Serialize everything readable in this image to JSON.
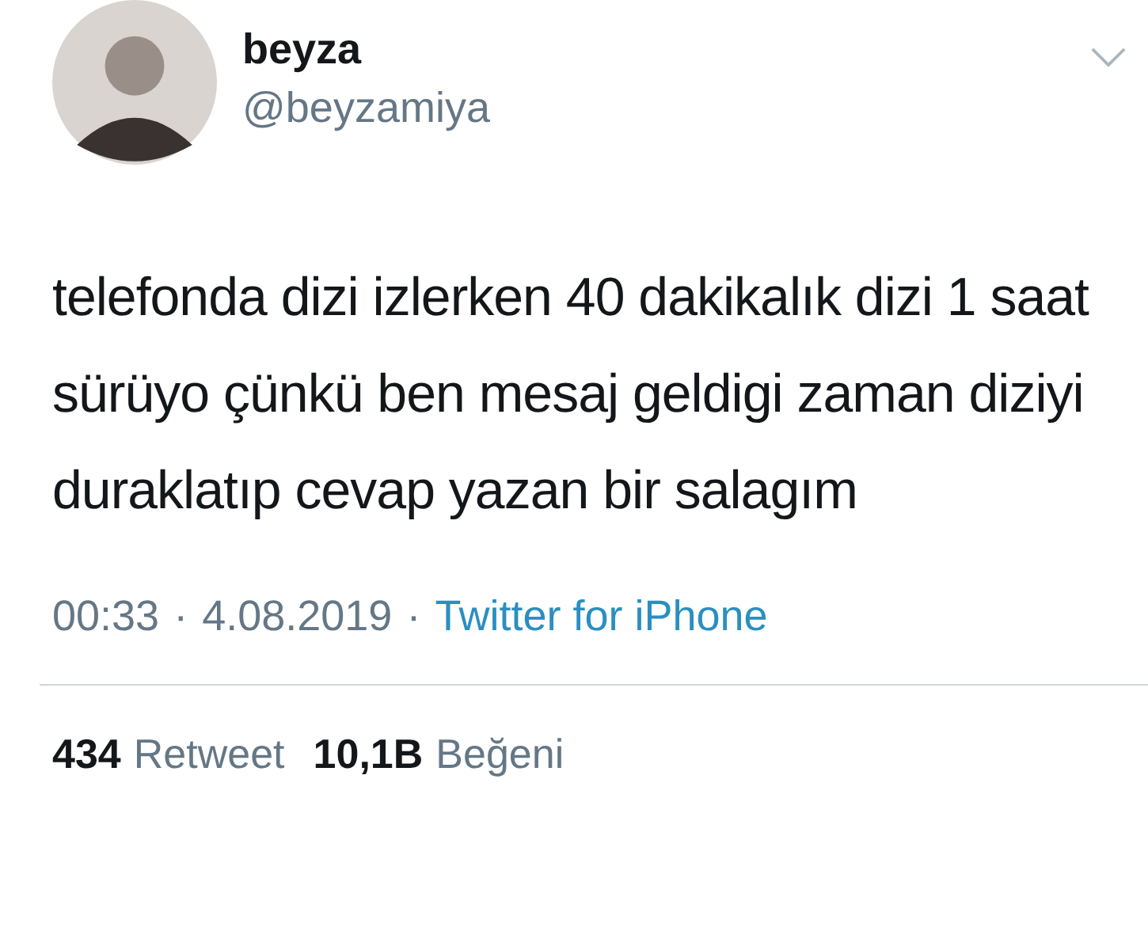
{
  "author": {
    "name": "beyza",
    "handle": "@beyzamiya"
  },
  "text": "telefonda dizi izlerken 40 dakikalık dizi 1 saat sürüyo çünkü ben mesaj geldigi zaman diziyi duraklatıp cevap yazan bir salagım",
  "meta": {
    "time": "00:33",
    "separator_1": "·",
    "date": "4.08.2019",
    "separator_2": "·",
    "source": "Twitter for iPhone"
  },
  "stats": [
    {
      "count": "434",
      "label": "Retweet"
    },
    {
      "count": "10,1B",
      "label": "Beğeni"
    }
  ]
}
